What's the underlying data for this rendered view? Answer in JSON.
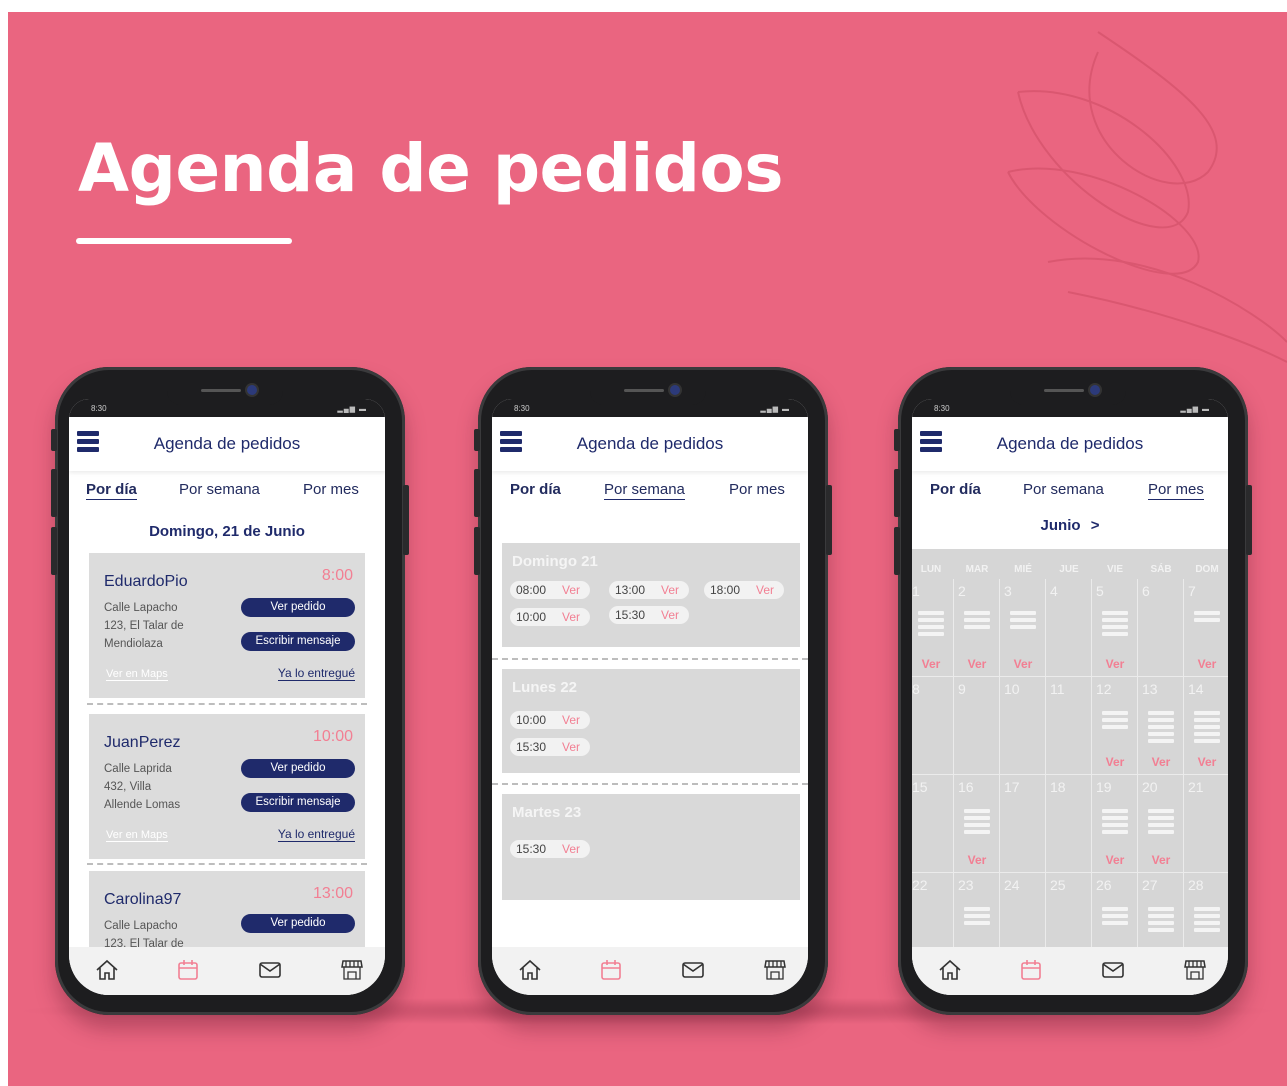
{
  "page": {
    "title": "Agenda de pedidos"
  },
  "colors": {
    "background": "#ea6580",
    "brand": "#1f2a6b",
    "accent": "#f27f93"
  },
  "phones": [
    {
      "status_time": "8:30",
      "app_title": "Agenda de pedidos",
      "tabs": [
        "Por día",
        "Por semana",
        "Por mes"
      ],
      "active_tab": "Por día",
      "day_title": "Domingo, 21 de Junio",
      "orders": [
        {
          "name": "EduardoPio",
          "time": "8:00",
          "address": [
            "Calle Lapacho",
            "123, El Talar de",
            "Mendiolaza"
          ],
          "btn_view": "Ver pedido",
          "btn_msg": "Escribir mensaje",
          "maps": "Ver en Maps",
          "done": "Ya lo entregué"
        },
        {
          "name": "JuanPerez",
          "time": "10:00",
          "address": [
            "Calle Laprida",
            "432, Villa",
            "Allende Lomas"
          ],
          "btn_view": "Ver pedido",
          "btn_msg": "Escribir mensaje",
          "maps": "Ver en Maps",
          "done": "Ya lo entregué"
        },
        {
          "name": "Carolina97",
          "time": "13:00",
          "address": [
            "Calle Lapacho",
            "123, El Talar de"
          ],
          "btn_view": "Ver pedido"
        }
      ],
      "nav": [
        "home-icon",
        "calendar-icon",
        "mail-icon",
        "store-icon"
      ]
    },
    {
      "status_time": "8:30",
      "app_title": "Agenda de pedidos",
      "tabs": [
        "Por día",
        "Por semana",
        "Por mes"
      ],
      "active_tab": "Por semana",
      "ver_label": "Ver",
      "days": [
        {
          "name": "Domingo 21",
          "slots": [
            "08:00",
            "13:00",
            "18:00",
            "10:00",
            "15:30"
          ]
        },
        {
          "name": "Lunes 22",
          "slots": [
            "10:00",
            "15:30"
          ]
        },
        {
          "name": "Martes 23",
          "slots": [
            "15:30"
          ]
        }
      ],
      "nav": [
        "home-icon",
        "calendar-icon",
        "mail-icon",
        "store-icon"
      ]
    },
    {
      "status_time": "8:30",
      "app_title": "Agenda de pedidos",
      "tabs": [
        "Por día",
        "Por semana",
        "Por mes"
      ],
      "active_tab": "Por mes",
      "month": "Junio",
      "weekdays": [
        "LUN",
        "MAR",
        "MIÉ",
        "JUE",
        "VIE",
        "SÁB",
        "DOM"
      ],
      "ver_label": "Ver",
      "days_with_orders": {
        "1": 4,
        "2": 3,
        "3": 3,
        "5": 4,
        "7": 2,
        "12": 3,
        "13": 5,
        "14": 5,
        "16": 4,
        "19": 4,
        "20": 4,
        "23": 3,
        "26": 3,
        "27": 4,
        "28": 4
      },
      "ver_days": [
        1,
        2,
        3,
        5,
        7,
        12,
        13,
        14,
        16,
        19,
        20
      ],
      "nav": [
        "home-icon",
        "calendar-icon",
        "mail-icon",
        "store-icon"
      ]
    }
  ]
}
